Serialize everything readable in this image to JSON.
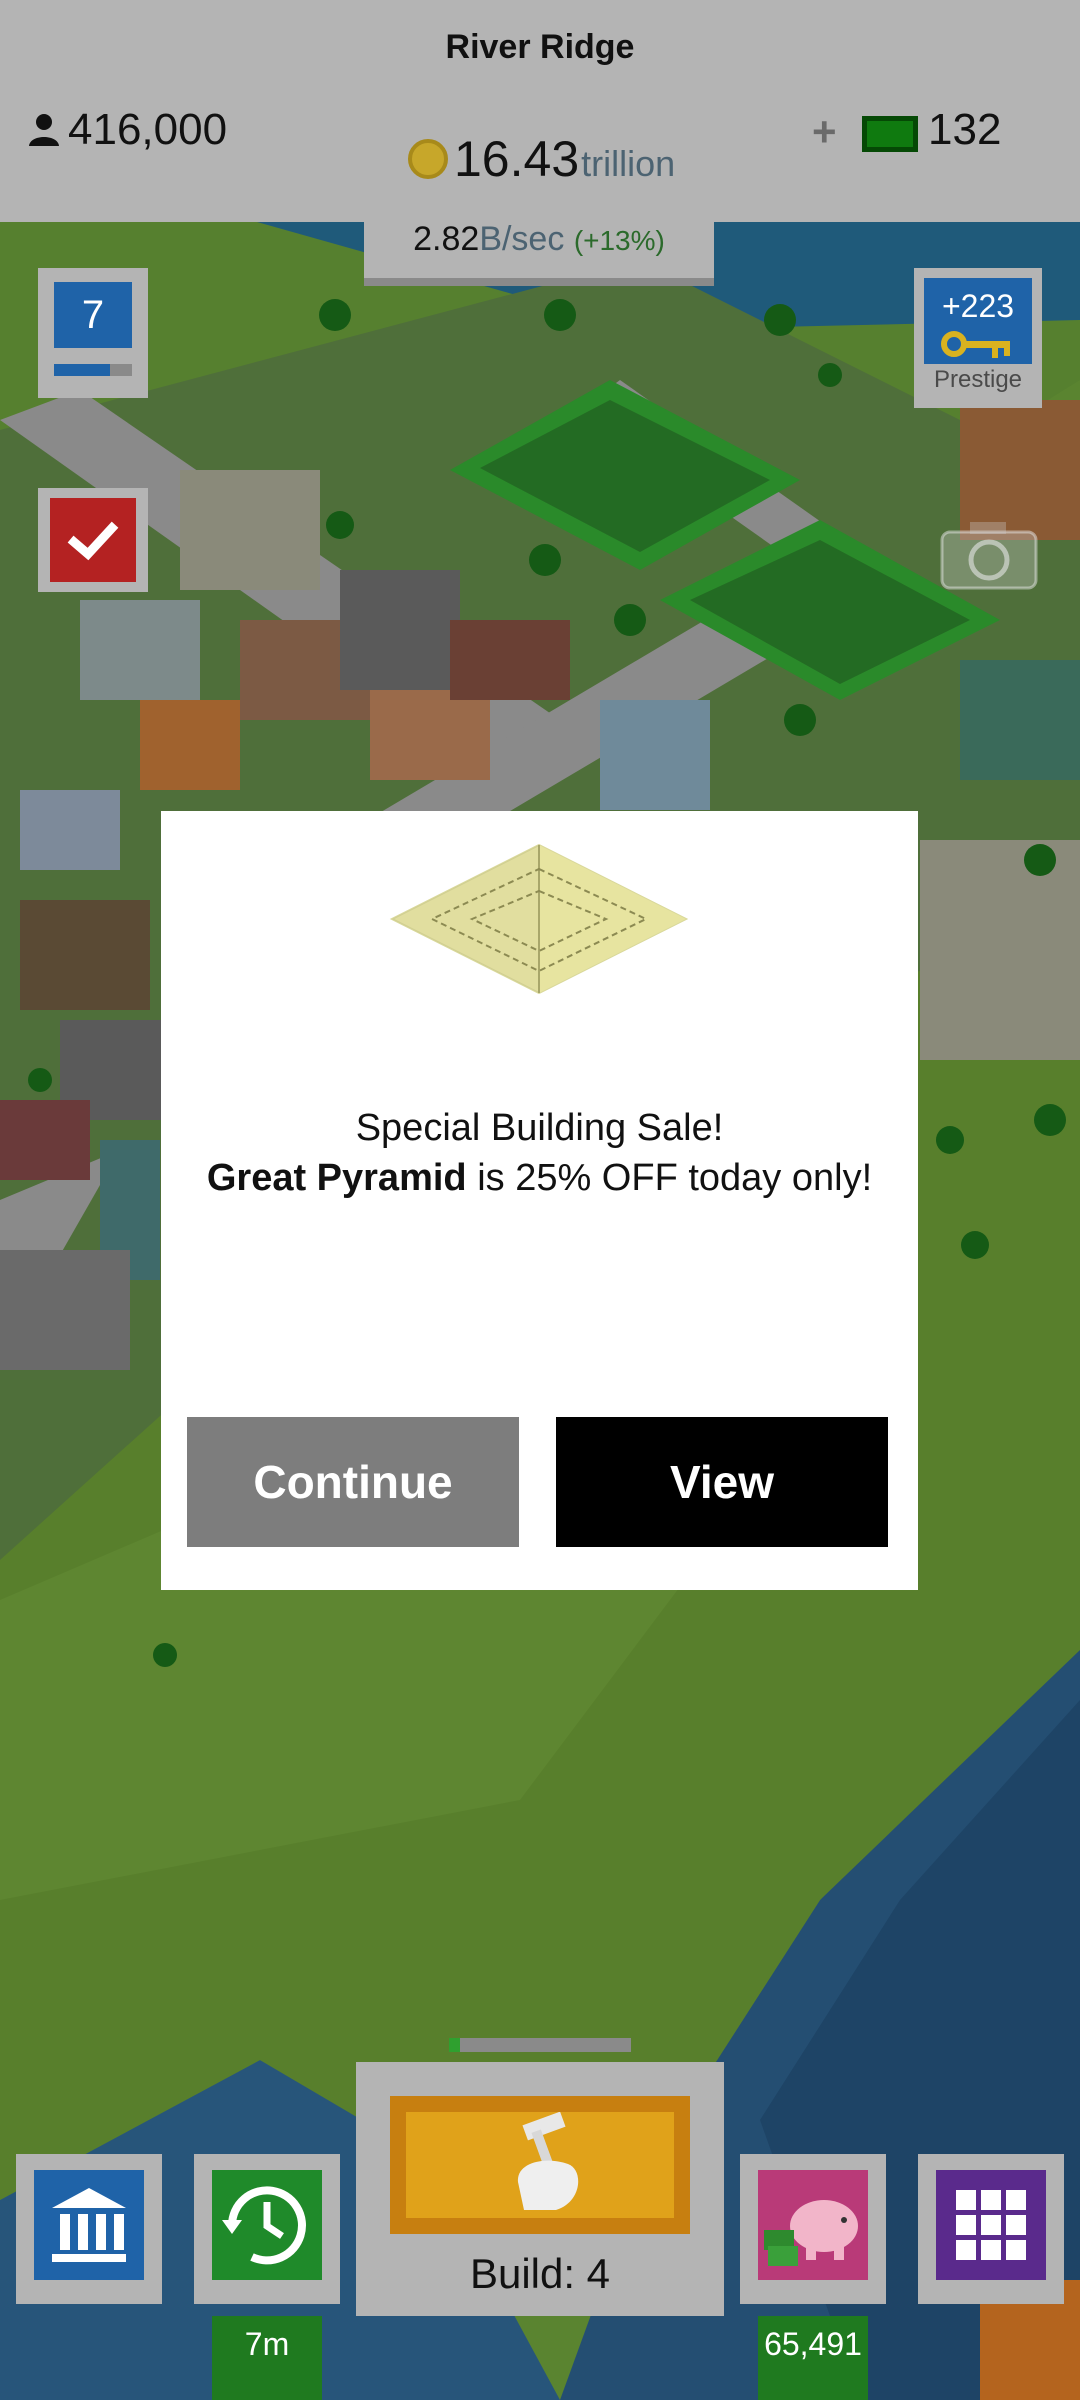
{
  "header": {
    "city_name": "River Ridge",
    "population": "416,000",
    "cash_amount": "16.43",
    "cash_unit": "trillion",
    "income_rate": "2.82",
    "income_unit": "B/sec",
    "income_bonus": "(+13%)",
    "plus_label": "+",
    "bills_count": "132"
  },
  "side": {
    "level": "7",
    "level_progress": 0.72,
    "prestige_count": "+223",
    "prestige_label": "Prestige"
  },
  "dialog": {
    "line1": "Special Building Sale!",
    "building_name": "Great Pyramid",
    "line2_rest": " is 25% OFF today only!",
    "continue_label": "Continue",
    "view_label": "View"
  },
  "bottom": {
    "build_label": "Build: 4",
    "build_progress": 0.06,
    "timer_label": "7m",
    "savings_label": "65,491"
  },
  "colors": {
    "topbar": "#b4b4b4",
    "level_blue": "#1f63a8",
    "check_red": "#b42222",
    "build_orange": "#e0a21a",
    "timer_green": "#1f7a1f",
    "piggy_pink": "#b93a78",
    "grid_purple": "#5a2a8c"
  },
  "icons": {
    "population": "person-icon",
    "cash": "coin-icon",
    "bills": "cash-bills-icon",
    "level": "level-badge",
    "check": "checkmark-icon",
    "prestige": "key-icon",
    "camera": "camera-icon",
    "bank": "bank-icon",
    "timer": "clock-refresh-icon",
    "build": "hammer-hand-icon",
    "savings": "piggy-bank-icon",
    "menu": "grid-menu-icon"
  }
}
